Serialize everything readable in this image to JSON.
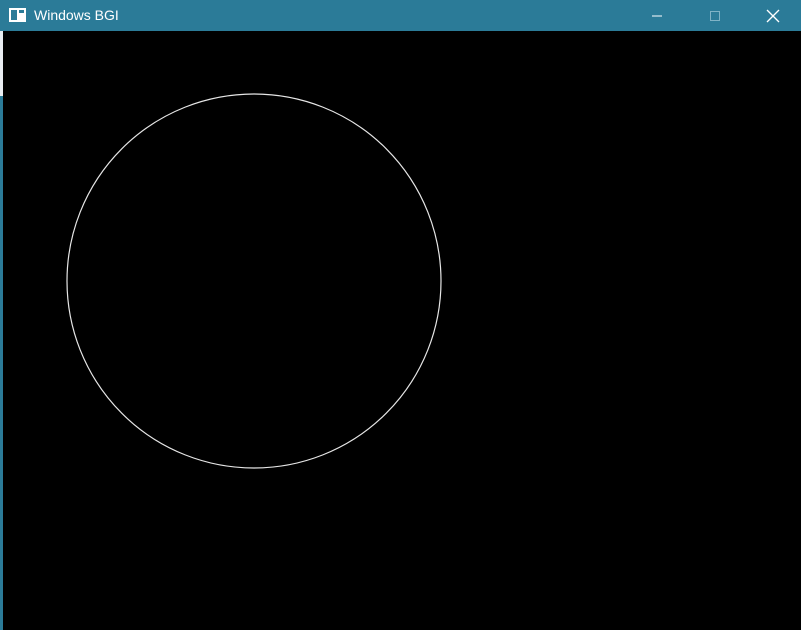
{
  "window": {
    "title": "Windows BGI",
    "accent_color": "#2b7b98",
    "canvas_background": "#000000",
    "shape_stroke_color": "#e6e6e6"
  },
  "titlebar": {
    "icons": {
      "app": "app-window-icon",
      "minimize": "minimize-icon",
      "maximize": "maximize-icon",
      "close": "close-icon"
    }
  }
}
